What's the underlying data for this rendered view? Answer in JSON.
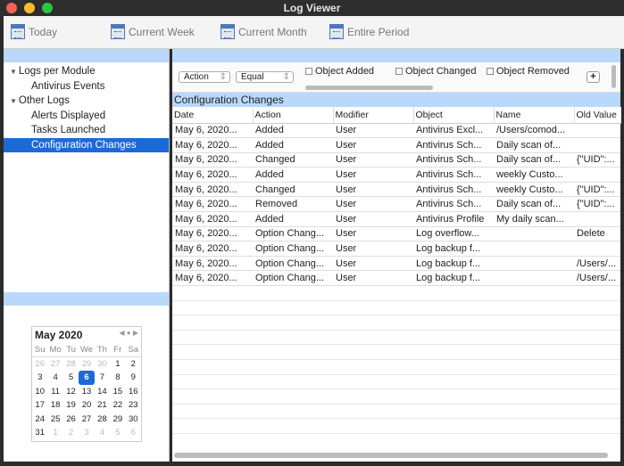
{
  "window": {
    "title": "Log Viewer"
  },
  "toolbar": {
    "today": "Today",
    "week": "Current Week",
    "month": "Current Month",
    "entire": "Entire Period"
  },
  "tree": [
    {
      "label": "Logs per Module",
      "level": 0,
      "expanded": true
    },
    {
      "label": "Antivirus Events",
      "level": 1
    },
    {
      "label": "Other Logs",
      "level": 0,
      "expanded": true
    },
    {
      "label": "Alerts Displayed",
      "level": 1
    },
    {
      "label": "Tasks Launched",
      "level": 1
    },
    {
      "label": "Configuration Changes",
      "level": 1,
      "selected": true
    }
  ],
  "calendar": {
    "title": "May 2020",
    "days_of_week": [
      "Su",
      "Mo",
      "Tu",
      "We",
      "Th",
      "Fr",
      "Sa"
    ],
    "days": [
      "26",
      "27",
      "28",
      "29",
      "30",
      "1",
      "2",
      "3",
      "4",
      "5",
      "6",
      "7",
      "8",
      "9",
      "10",
      "11",
      "12",
      "13",
      "14",
      "15",
      "16",
      "17",
      "18",
      "19",
      "20",
      "21",
      "22",
      "23",
      "24",
      "25",
      "26",
      "27",
      "28",
      "29",
      "30",
      "31",
      "1",
      "2",
      "3",
      "4",
      "5",
      "6"
    ],
    "selected": "6"
  },
  "filter": {
    "field": "Action",
    "operator": "Equal",
    "checks": [
      "Object Added",
      "Object Changed",
      "Object Removed"
    ],
    "add": "+"
  },
  "section_title": "Configuration Changes",
  "columns": [
    "Date",
    "Action",
    "Modifier",
    "Object",
    "Name",
    "Old Value"
  ],
  "rows": [
    [
      "May 6, 2020...",
      "Added",
      "User",
      "Antivirus Excl...",
      "/Users/comod...",
      ""
    ],
    [
      "May 6, 2020...",
      "Added",
      "User",
      "Antivirus Sch...",
      "Daily scan of...",
      ""
    ],
    [
      "May 6, 2020...",
      "Changed",
      "User",
      "Antivirus Sch...",
      "Daily scan of...",
      "{\"UID\":..."
    ],
    [
      "May 6, 2020...",
      "Added",
      "User",
      "Antivirus Sch...",
      "weekly Custo...",
      ""
    ],
    [
      "May 6, 2020...",
      "Changed",
      "User",
      "Antivirus Sch...",
      "weekly Custo...",
      "{\"UID\":..."
    ],
    [
      "May 6, 2020...",
      "Removed",
      "User",
      "Antivirus Sch...",
      "Daily scan of...",
      "{\"UID\":..."
    ],
    [
      "May 6, 2020...",
      "Added",
      "User",
      "Antivirus Profile",
      "My daily scan...",
      ""
    ],
    [
      "May 6, 2020...",
      "Option Chang...",
      "User",
      "Log overflow...",
      "",
      "Delete"
    ],
    [
      "May 6, 2020...",
      "Option Chang...",
      "User",
      "Log backup f...",
      "",
      ""
    ],
    [
      "May 6, 2020...",
      "Option Chang...",
      "User",
      "Log backup f...",
      "",
      "/Users/..."
    ],
    [
      "May 6, 2020...",
      "Option Chang...",
      "User",
      "Log backup f...",
      "",
      "/Users/..."
    ]
  ]
}
